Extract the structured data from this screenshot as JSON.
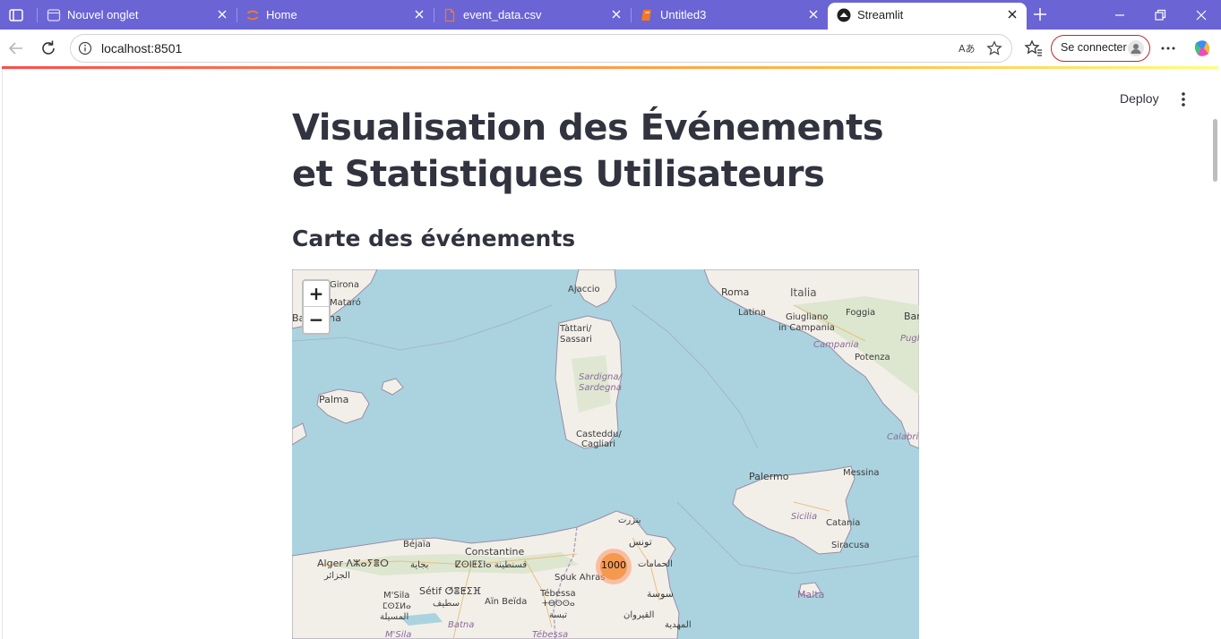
{
  "browser": {
    "tabs": [
      {
        "label": "Nouvel onglet",
        "icon": "new-tab-icon"
      },
      {
        "label": "Home",
        "icon": "jupyter-icon"
      },
      {
        "label": "event_data.csv",
        "icon": "file-icon"
      },
      {
        "label": "Untitled3",
        "icon": "notebook-icon"
      },
      {
        "label": "Streamlit",
        "icon": "streamlit-icon",
        "active": true
      }
    ],
    "address": "localhost:8501",
    "signin_label": "Se connecter"
  },
  "app": {
    "deploy_label": "Deploy",
    "title": "Visualisation des Événements et Statistiques Utilisateurs",
    "section_title": "Carte des événements"
  },
  "map": {
    "zoom_in": "+",
    "zoom_out": "−",
    "cluster_count": "1000",
    "labels": {
      "girona": "Girona",
      "mataro": "Mataró",
      "barcelona": "Barcelona",
      "ajaccio": "Ajaccio",
      "roma": "Roma",
      "italia": "Italia",
      "latina": "Latina",
      "giugliano": "Giugliano",
      "in_campania": "in Campania",
      "foggia": "Foggia",
      "bari": "Bar",
      "campania": "Campania",
      "puglia": "Pugli",
      "potenza": "Potenza",
      "tattari": "Tàttari/",
      "sassari": "Sassari",
      "sardigna": "Sardigna/",
      "sardegna": "Sardegna",
      "palma": "Palma",
      "casteddu": "Casteddu/",
      "cagliari": "Cagliari",
      "calabria": "Calabri",
      "messina": "Messina",
      "palermo": "Palermo",
      "sicilia": "Sicilia",
      "catania": "Catania",
      "siracusa": "Siracusa",
      "bizerte": "بنزرت",
      "tunis": "تونس",
      "bejaia": "Béjaïa",
      "bejaia_ar": "بجاية",
      "constantine": "Constantine",
      "constantine_tz": "ⵇⵙⵏⵟⵉⵏⴰ قسنطينة",
      "alger": "Alger ⴷⵣⴰⵢⴻⵔ",
      "alger_ar": "الجزائر",
      "hammamet": "الحمامات",
      "souk_ahras": "Souk Ahras",
      "msila": "M'Sila",
      "msila_tz": "ⵎⵙⵉⵍⴰ",
      "msila_ar": "المسيلة",
      "setif": "Sétif ⵚⴻⵟⵉⴼ",
      "setif_ar": "سطيف",
      "ain_beida": "Aïn Beïda",
      "tebessa": "Tébessa",
      "tebessa_tz": "ⵜⴱⵙⵙⴰ",
      "tebessa_ar": "تبسة",
      "sousse": "سوسة",
      "kairouan": "القيروان",
      "mahdia": "المهدية",
      "malta": "Malta",
      "batna": "Batna",
      "msila_region": "M'Sila",
      "tebessa_region": "Tébessa"
    }
  }
}
